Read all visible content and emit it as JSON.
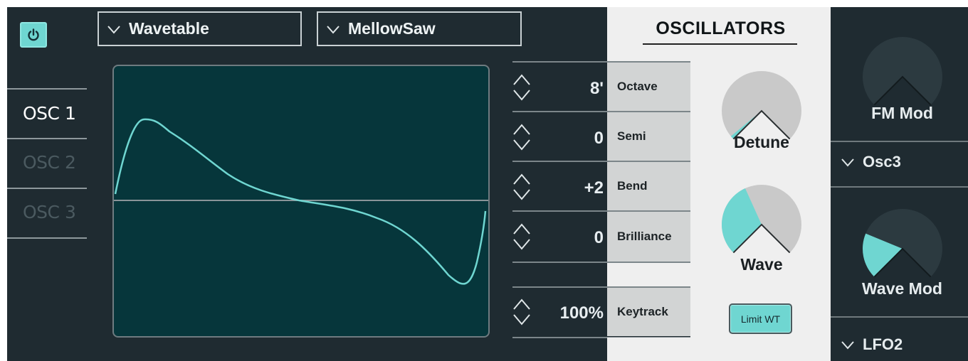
{
  "header": {
    "power_glyph": "⏻",
    "wavetable_dropdown": "Wavetable",
    "preset_dropdown": "MellowSaw",
    "section_title": "OSCILLATORS"
  },
  "tabs": [
    {
      "label": "OSC 1",
      "active": true
    },
    {
      "label": "OSC 2",
      "active": false
    },
    {
      "label": "OSC 3",
      "active": false
    }
  ],
  "params": [
    {
      "value": "8'",
      "label": "Octave"
    },
    {
      "value": "0",
      "label": "Semi"
    },
    {
      "value": "+2",
      "label": "Bend"
    },
    {
      "value": "0",
      "label": "Brilliance"
    },
    {
      "value": "100%",
      "label": "Keytrack"
    }
  ],
  "knobs": {
    "detune": {
      "label": "Detune",
      "value_fraction": 0.02
    },
    "wave": {
      "label": "Wave",
      "value_fraction": 0.41
    },
    "fm_mod": {
      "label": "FM Mod",
      "value_fraction": 0.0
    },
    "wave_mod": {
      "label": "Wave Mod",
      "value_fraction": 0.25
    }
  },
  "limit_button": "Limit WT",
  "mod_sources": {
    "fm_source": "Osc3",
    "wave_source": "LFO2"
  },
  "colors": {
    "accent": "#6fd6d1",
    "panel_dark": "#1f2b31",
    "display_bg": "#06363b",
    "panel_light": "#efefef"
  }
}
